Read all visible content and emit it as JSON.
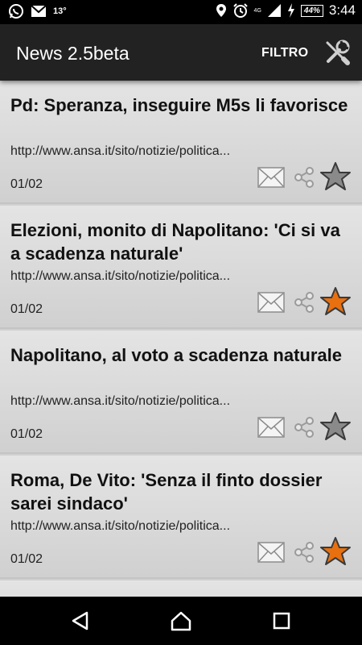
{
  "status_bar": {
    "temperature": "13°",
    "network": "4G",
    "battery": "44%",
    "time": "3:44",
    "icons": [
      "whatsapp-icon",
      "gmail-icon",
      "location-icon",
      "alarm-icon",
      "signal-icon",
      "charging-icon"
    ]
  },
  "app_bar": {
    "title": "News 2.5beta",
    "filter_label": "FILTRO",
    "settings_icon": "wrench-screwdriver-icon"
  },
  "news": [
    {
      "title": "Pd: Speranza, inseguire M5s li favorisce",
      "url": "http://www.ansa.it/sito/notizie/politica...",
      "date": "01/02",
      "starred": false
    },
    {
      "title": "Elezioni, monito di Napolitano: 'Ci si va a scadenza naturale'",
      "url": "http://www.ansa.it/sito/notizie/politica...",
      "date": "01/02",
      "starred": true
    },
    {
      "title": "Napolitano, al voto a scadenza naturale",
      "url": "http://www.ansa.it/sito/notizie/politica...",
      "date": "01/02",
      "starred": false
    },
    {
      "title": "Roma, De Vito: 'Senza il finto dossier sarei sindaco'",
      "url": "http://www.ansa.it/sito/notizie/politica...",
      "date": "01/02",
      "starred": true
    }
  ],
  "colors": {
    "app_bar": "#222222",
    "star_active": "#e8700f",
    "star_inactive": "#8a8a8a",
    "card_background": "#dcdcdc"
  },
  "nav_bar": {
    "icons": [
      "back-icon",
      "home-icon",
      "recents-icon"
    ]
  }
}
